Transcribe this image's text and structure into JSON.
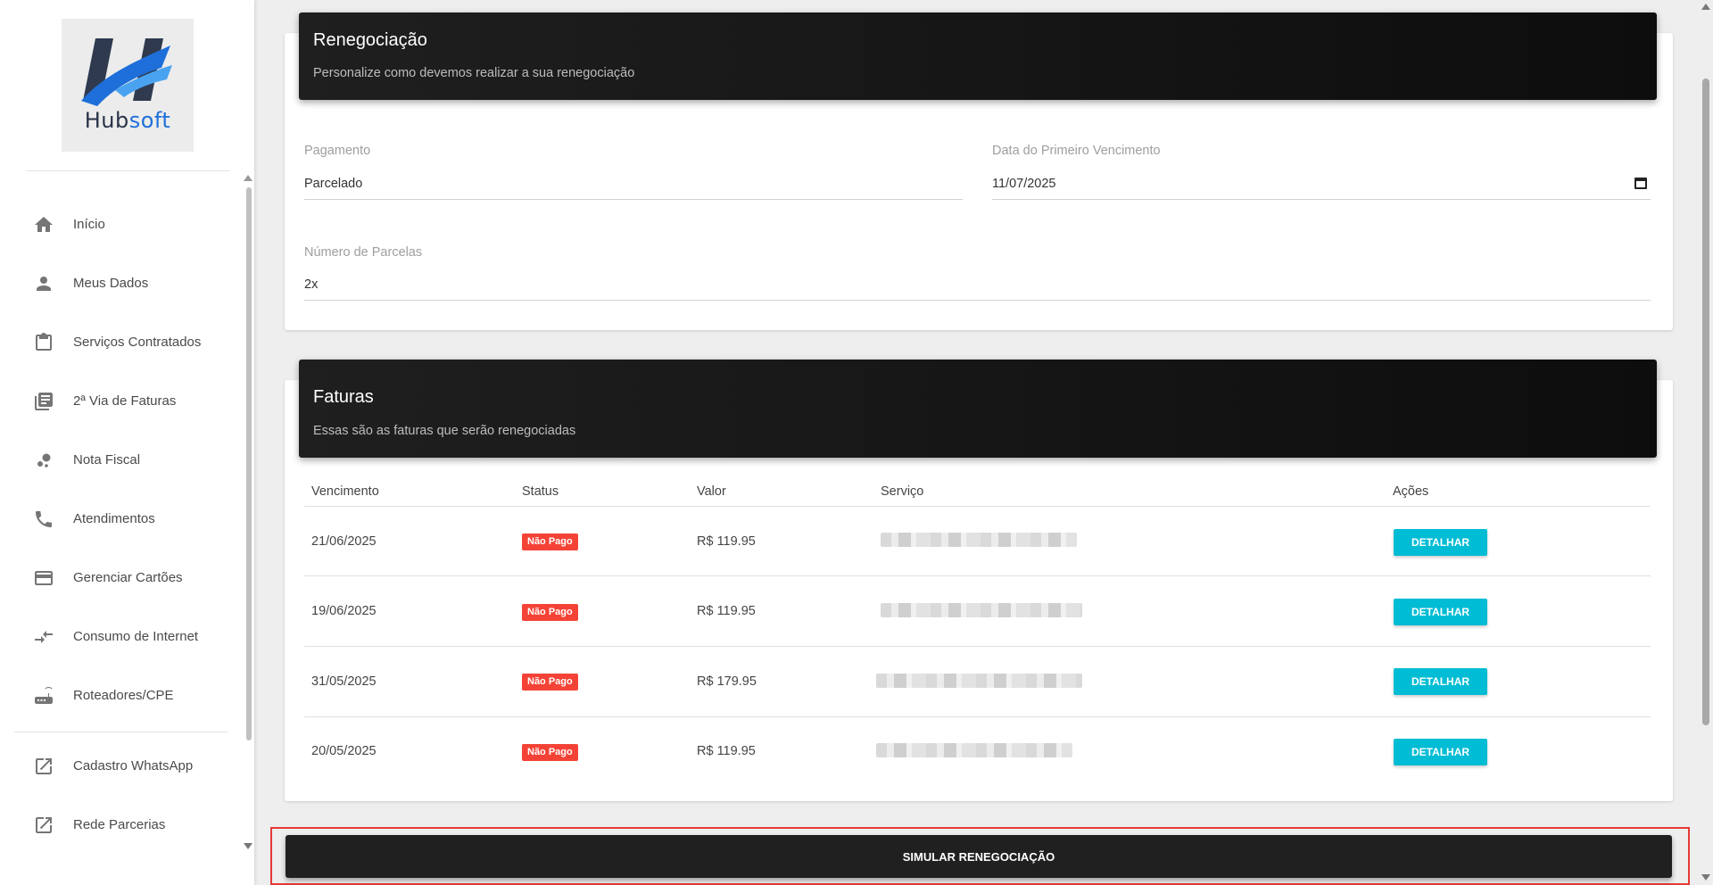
{
  "brand": {
    "logo_part1": "Hub",
    "logo_part2": "soft"
  },
  "sidebar": {
    "items": [
      {
        "label": "Início",
        "icon": "home-icon"
      },
      {
        "label": "Meus Dados",
        "icon": "person-icon"
      },
      {
        "label": "Serviços Contratados",
        "icon": "clipboard-icon"
      },
      {
        "label": "2ª Via de Faturas",
        "icon": "library-books-icon"
      },
      {
        "label": "Nota Fiscal",
        "icon": "bubbles-icon"
      },
      {
        "label": "Atendimentos",
        "icon": "phone-icon"
      },
      {
        "label": "Gerenciar Cartões",
        "icon": "credit-card-icon"
      },
      {
        "label": "Consumo de Internet",
        "icon": "compare-arrows-icon"
      },
      {
        "label": "Roteadores/CPE",
        "icon": "router-icon"
      }
    ],
    "external_items": [
      {
        "label": "Cadastro WhatsApp",
        "icon": "open-in-new-icon"
      },
      {
        "label": "Rede Parcerias",
        "icon": "open-in-new-icon"
      }
    ]
  },
  "renegociacao": {
    "title": "Renegociação",
    "subtitle": "Personalize como devemos realizar a sua renegociação",
    "pagamento_label": "Pagamento",
    "pagamento_value": "Parcelado",
    "vencimento_label": "Data do Primeiro Vencimento",
    "vencimento_value": "11/07/2025",
    "parcelas_label": "Número de Parcelas",
    "parcelas_value": "2x"
  },
  "faturas": {
    "title": "Faturas",
    "subtitle": "Essas são as faturas que serão renegociadas",
    "columns": [
      "Vencimento",
      "Status",
      "Valor",
      "Serviço",
      "Ações"
    ],
    "rows": [
      {
        "vencimento": "21/06/2025",
        "status": "Não Pago",
        "valor": "R$ 119.95",
        "acao": "DETALHAR"
      },
      {
        "vencimento": "19/06/2025",
        "status": "Não Pago",
        "valor": "R$ 119.95",
        "acao": "DETALHAR"
      },
      {
        "vencimento": "31/05/2025",
        "status": "Não Pago",
        "valor": "R$ 179.95",
        "acao": "DETALHAR"
      },
      {
        "vencimento": "20/05/2025",
        "status": "Não Pago",
        "valor": "R$ 119.95",
        "acao": "DETALHAR"
      }
    ]
  },
  "simular_button": "SIMULAR RENEGOCIAÇÃO",
  "colors": {
    "accent": "#00bcd4",
    "danger": "#f44336",
    "header_dark": "#1a1a1a",
    "logo_blue": "#1e6fd9"
  }
}
